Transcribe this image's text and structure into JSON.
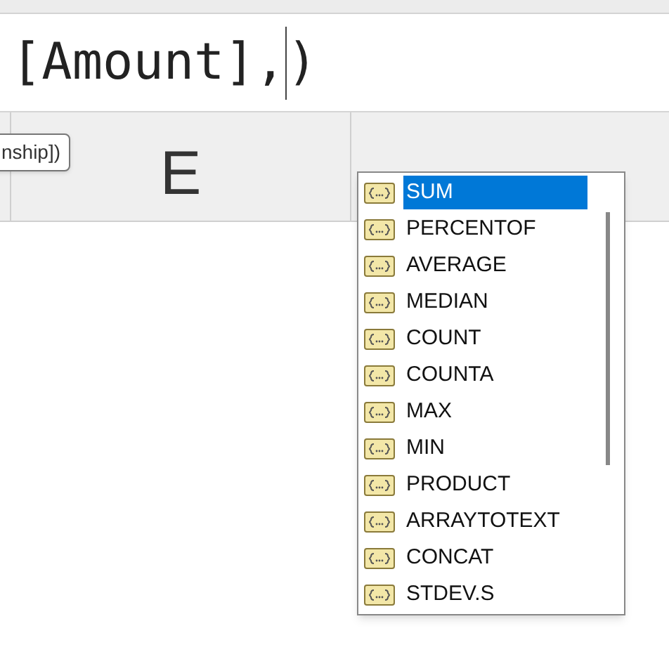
{
  "formula_bar": {
    "before_cursor": "[Amount],",
    "after_cursor": ")"
  },
  "tooltip": {
    "text": "nship])"
  },
  "column_headers": [
    {
      "label": "E"
    }
  ],
  "autocomplete": {
    "items": [
      {
        "label": "SUM",
        "selected": true
      },
      {
        "label": "PERCENTOF",
        "selected": false
      },
      {
        "label": "AVERAGE",
        "selected": false
      },
      {
        "label": "MEDIAN",
        "selected": false
      },
      {
        "label": "COUNT",
        "selected": false
      },
      {
        "label": "COUNTA",
        "selected": false
      },
      {
        "label": "MAX",
        "selected": false
      },
      {
        "label": "MIN",
        "selected": false
      },
      {
        "label": "PRODUCT",
        "selected": false
      },
      {
        "label": "ARRAYTOTEXT",
        "selected": false
      },
      {
        "label": "CONCAT",
        "selected": false
      },
      {
        "label": "STDEV.S",
        "selected": false
      }
    ]
  }
}
